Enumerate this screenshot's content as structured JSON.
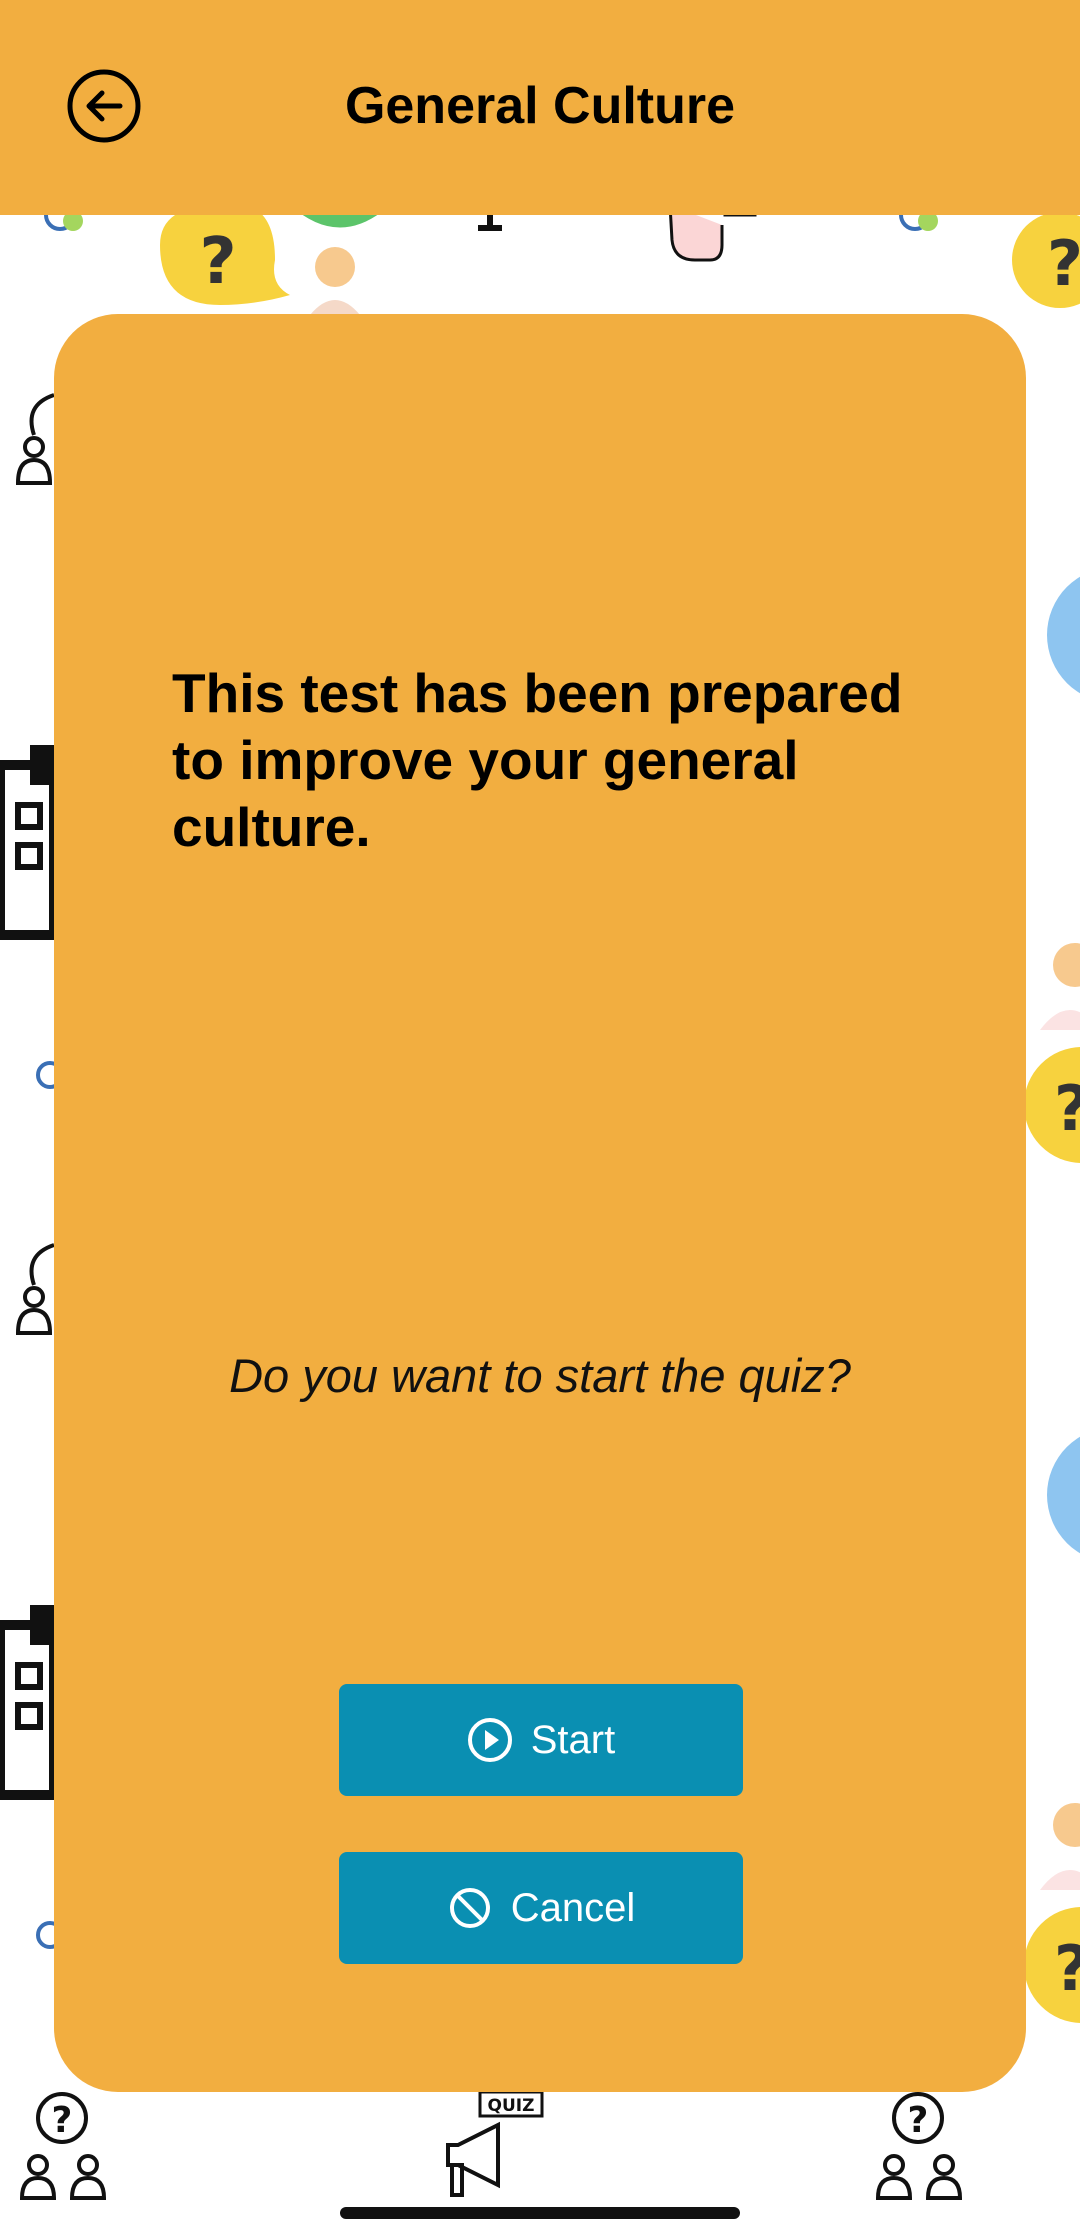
{
  "header": {
    "title": "General Culture",
    "back_icon": "arrow-left-circle-icon",
    "background_color": "#F2AE40"
  },
  "dialog": {
    "message": "This test has been prepared to improve your general culture.",
    "question": "Do you want to start the quiz?",
    "start_label": "Start",
    "start_icon": "play-circle-icon",
    "cancel_label": "Cancel",
    "cancel_icon": "ban-icon",
    "button_color": "#0A8FB2",
    "card_color": "#F2AE40"
  },
  "background": {
    "quiz_badge_text": "QUIZ",
    "question_mark": "?"
  }
}
